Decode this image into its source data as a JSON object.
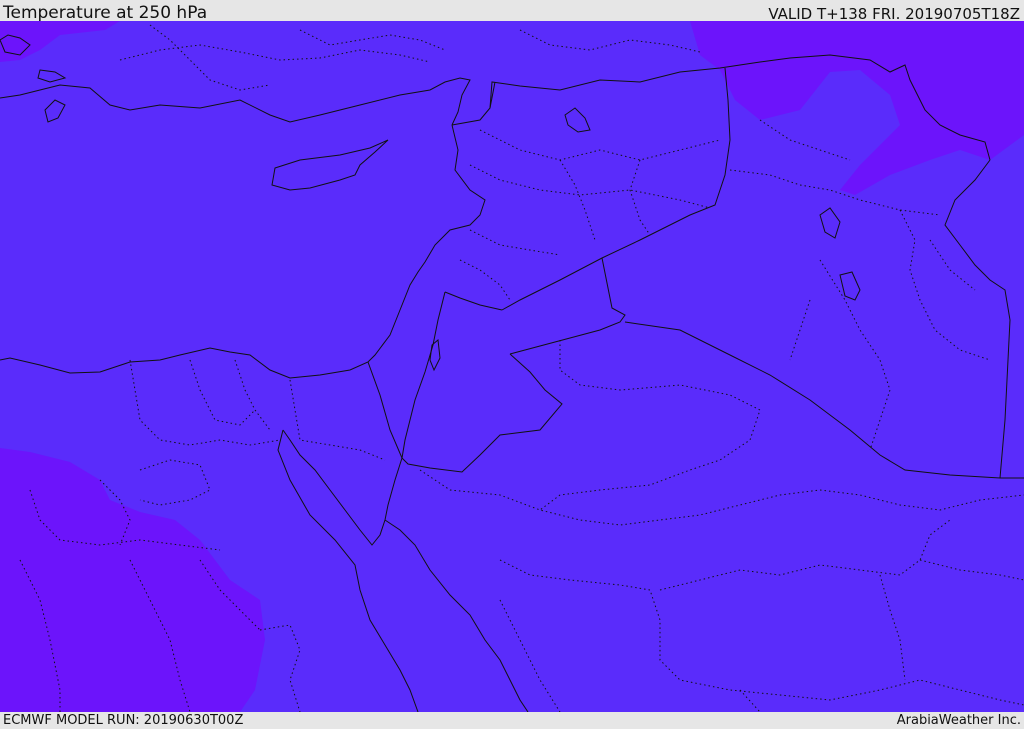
{
  "header": {
    "title": "Temperature at 250 hPa",
    "valid_time": "VALID T+138 FRI. 20190705T18Z"
  },
  "footer": {
    "model_run": "ECMWF MODEL RUN: 20190630T00Z",
    "credit": "ArabiaWeather Inc."
  },
  "map": {
    "field": "Temperature",
    "level": "250 hPa",
    "colors": {
      "base_fill": "#5a2cfb",
      "colder_fill": "#6c14fb",
      "light_fill": "#6d2ef3",
      "border_line": "#111111"
    }
  }
}
